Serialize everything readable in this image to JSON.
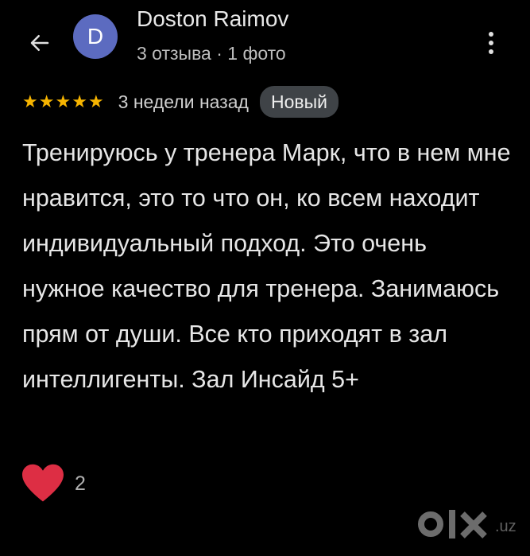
{
  "header": {
    "back_icon": "arrow-left-icon",
    "avatar_letter": "D",
    "avatar_color": "#5c6bc0",
    "user_name": "Doston Raimov",
    "user_meta": "3 отзыва · 1 фото",
    "more_icon": "more-vertical-icon"
  },
  "review": {
    "rating": 5,
    "rating_max": 5,
    "star_color": "#f6b400",
    "stars": [
      "★",
      "★",
      "★",
      "★",
      "★"
    ],
    "date": "3 недели назад",
    "badge": "Новый",
    "text": "Тренируюсь у тренера Марк, что в нем мне нравится, это то что он, ко всем находит индивидуальный подход. Это очень нужное качество для тренера. Занимаюсь прям от души. Все кто приходят в зал интеллигенты. Зал Инсайд 5+"
  },
  "reactions": {
    "heart_icon": "red-heart-icon",
    "heart_color": "#dd2e44",
    "count": "2"
  },
  "watermark": {
    "brand": "olx",
    "domain": ".uz"
  }
}
